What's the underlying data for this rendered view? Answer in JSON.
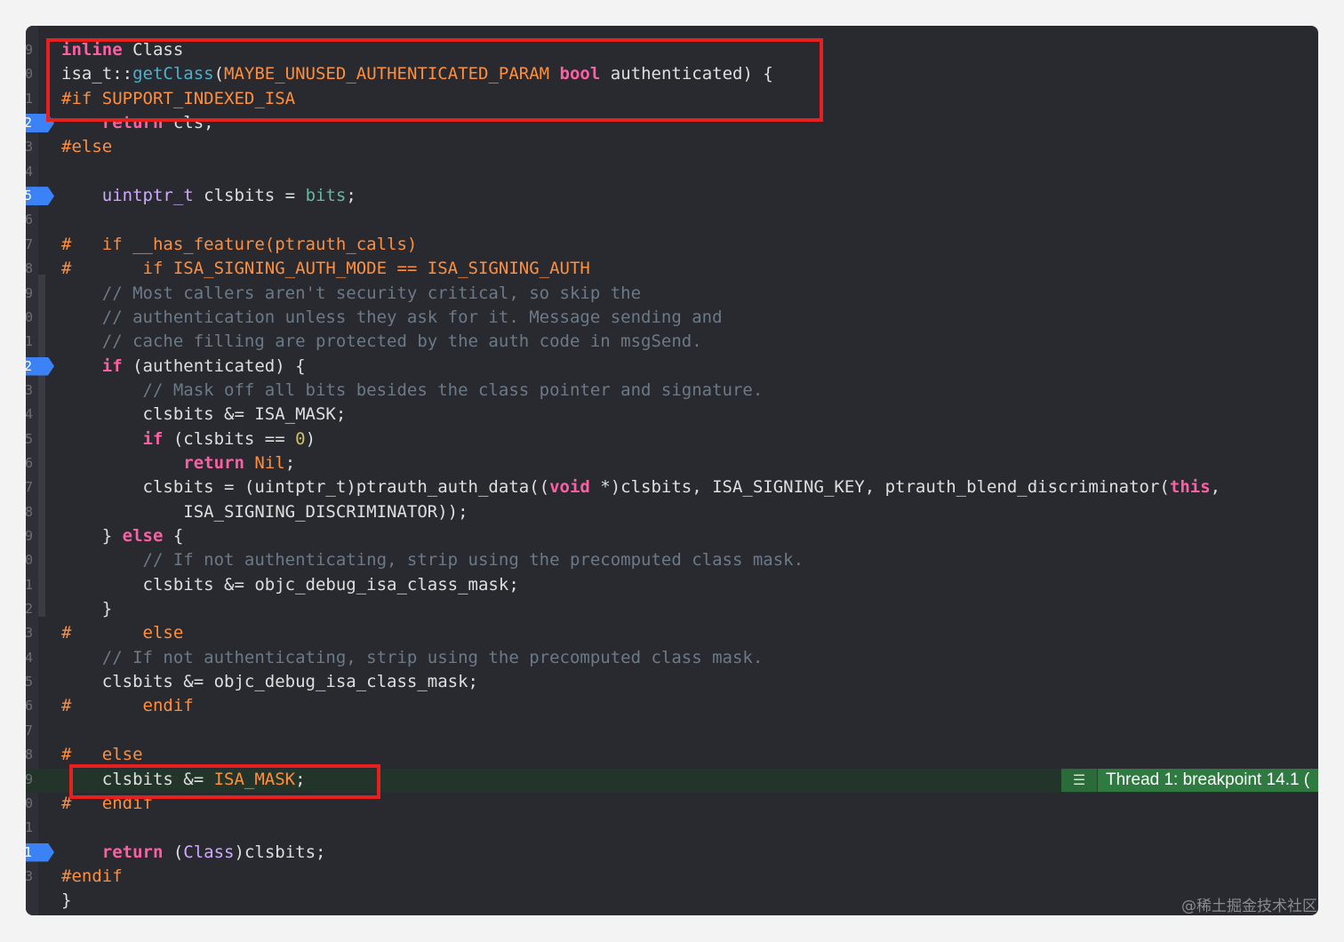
{
  "colors": {
    "keyword": "#fc5fa3",
    "preprocessor": "#fd8f3f",
    "comment": "#6c7986",
    "type": "#d0a8ff",
    "function": "#4eb0cc",
    "member": "#67b7a4",
    "number": "#d0bf69",
    "plain": "#dfdfe0",
    "breakpoint": "#3b82f6",
    "highlight_box": "#e5201f"
  },
  "gutter_numbers": [
    "9",
    "0",
    "1",
    "2",
    "3",
    "4",
    "5",
    "6",
    "7",
    "8",
    "9",
    "0",
    "1",
    "2",
    "3",
    "4",
    "5",
    "6",
    "7",
    "8",
    "9",
    "0",
    "1",
    "2",
    "3",
    "4",
    "5",
    "6",
    "7",
    "8",
    "9",
    "0",
    "1",
    "2",
    "3"
  ],
  "breakpoints": [
    "2",
    "5",
    "2",
    "1"
  ],
  "lines": [
    [
      {
        "t": "inline",
        "c": "kw"
      },
      {
        "t": " Class",
        "c": "pl"
      }
    ],
    [
      {
        "t": "isa_t::",
        "c": "pl"
      },
      {
        "t": "getClass",
        "c": "fn"
      },
      {
        "t": "(",
        "c": "pl"
      },
      {
        "t": "MAYBE_UNUSED_AUTHENTICATED_PARAM",
        "c": "pp"
      },
      {
        "t": " ",
        "c": "pl"
      },
      {
        "t": "bool",
        "c": "kw"
      },
      {
        "t": " authenticated) {",
        "c": "pl"
      }
    ],
    [
      {
        "t": "#if SUPPORT_INDEXED_ISA",
        "c": "pp"
      }
    ],
    [
      {
        "t": "    ",
        "c": "pl"
      },
      {
        "t": "return",
        "c": "kw"
      },
      {
        "t": " cls;",
        "c": "pl"
      }
    ],
    [
      {
        "t": "#else",
        "c": "pp"
      }
    ],
    [],
    [
      {
        "t": "    ",
        "c": "pl"
      },
      {
        "t": "uintptr_t",
        "c": "ty"
      },
      {
        "t": " clsbits = ",
        "c": "pl"
      },
      {
        "t": "bits",
        "c": "mb"
      },
      {
        "t": ";",
        "c": "pl"
      }
    ],
    [],
    [
      {
        "t": "#   if __has_feature(ptrauth_calls)",
        "c": "pp"
      }
    ],
    [
      {
        "t": "#       if ISA_SIGNING_AUTH_MODE == ISA_SIGNING_AUTH",
        "c": "pp"
      }
    ],
    [
      {
        "t": "    // Most callers aren't security critical, so skip the",
        "c": "cm"
      }
    ],
    [
      {
        "t": "    // authentication unless they ask for it. Message sending and",
        "c": "cm"
      }
    ],
    [
      {
        "t": "    // cache filling are protected by the auth code in msgSend.",
        "c": "cm"
      }
    ],
    [
      {
        "t": "    ",
        "c": "pl"
      },
      {
        "t": "if",
        "c": "kw"
      },
      {
        "t": " (authenticated) {",
        "c": "pl"
      }
    ],
    [
      {
        "t": "        // Mask off all bits besides the class pointer and signature.",
        "c": "cm"
      }
    ],
    [
      {
        "t": "        clsbits &= ISA_MASK;",
        "c": "pl"
      }
    ],
    [
      {
        "t": "        ",
        "c": "pl"
      },
      {
        "t": "if",
        "c": "kw"
      },
      {
        "t": " (clsbits == ",
        "c": "pl"
      },
      {
        "t": "0",
        "c": "nm"
      },
      {
        "t": ")",
        "c": "pl"
      }
    ],
    [
      {
        "t": "            ",
        "c": "pl"
      },
      {
        "t": "return",
        "c": "kw"
      },
      {
        "t": " ",
        "c": "pl"
      },
      {
        "t": "Nil",
        "c": "pp"
      },
      {
        "t": ";",
        "c": "pl"
      }
    ],
    [
      {
        "t": "        clsbits = (uintptr_t)ptrauth_auth_data((",
        "c": "pl"
      },
      {
        "t": "void",
        "c": "kw"
      },
      {
        "t": " *)clsbits, ISA_SIGNING_KEY, ptrauth_blend_discriminator(",
        "c": "pl"
      },
      {
        "t": "this",
        "c": "kw"
      },
      {
        "t": ",",
        "c": "pl"
      }
    ],
    [
      {
        "t": "            ISA_SIGNING_DISCRIMINATOR));",
        "c": "pl"
      }
    ],
    [
      {
        "t": "    } ",
        "c": "pl"
      },
      {
        "t": "else",
        "c": "kw"
      },
      {
        "t": " {",
        "c": "pl"
      }
    ],
    [
      {
        "t": "        // If not authenticating, strip using the precomputed class mask.",
        "c": "cm"
      }
    ],
    [
      {
        "t": "        clsbits &= objc_debug_isa_class_mask;",
        "c": "pl"
      }
    ],
    [
      {
        "t": "    }",
        "c": "pl"
      }
    ],
    [
      {
        "t": "#       else",
        "c": "pp"
      }
    ],
    [
      {
        "t": "    // If not authenticating, strip using the precomputed class mask.",
        "c": "cm"
      }
    ],
    [
      {
        "t": "    clsbits &= objc_debug_isa_class_mask;",
        "c": "pl"
      }
    ],
    [
      {
        "t": "#       endif",
        "c": "pp"
      }
    ],
    [],
    [
      {
        "t": "#   else",
        "c": "pp"
      }
    ],
    [
      {
        "t": "    clsbits &= ",
        "c": "pl"
      },
      {
        "t": "ISA_MASK",
        "c": "pp"
      },
      {
        "t": ";",
        "c": "pl"
      }
    ],
    [
      {
        "t": "#   endif",
        "c": "pp"
      }
    ],
    [],
    [
      {
        "t": "    ",
        "c": "pl"
      },
      {
        "t": "return",
        "c": "kw"
      },
      {
        "t": " (",
        "c": "pl"
      },
      {
        "t": "Class",
        "c": "ty"
      },
      {
        "t": ")clsbits;",
        "c": "pl"
      }
    ],
    [
      {
        "t": "#endif",
        "c": "pp"
      }
    ],
    [
      {
        "t": "}",
        "c": "pl"
      }
    ]
  ],
  "thread_badge": {
    "icon": "list-icon",
    "label": "Thread 1: breakpoint 14.1 ("
  },
  "watermark": "@稀土掘金技术社区"
}
